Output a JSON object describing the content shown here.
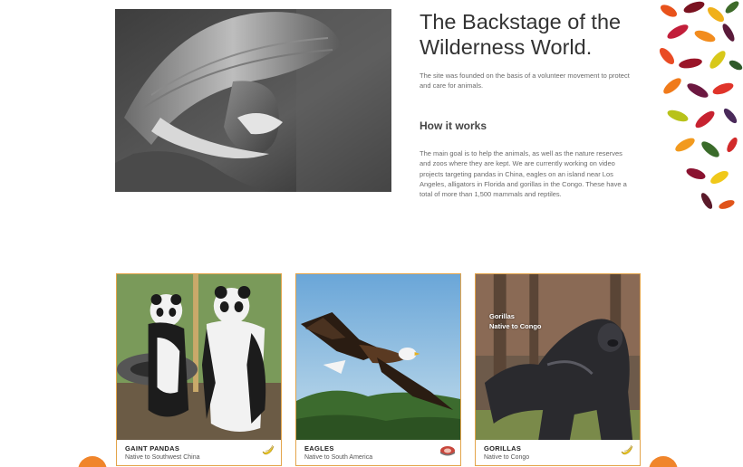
{
  "hero": {
    "title": "The Backstage of the Wilderness World.",
    "intro": "The site was founded on the basis of a volunteer movement to protect and care for animals.",
    "how_title": "How it works",
    "how_body": "The main goal is to help the animals, as well as the nature reserves and zoos where they are kept. We are currently working on video projects targeting pandas in China, eagles on an island near Los Angeles, alligators in Florida and gorillas in the Congo. These have a total of more than 1,500 mammals and reptiles.",
    "photo_icon": "old-man-portrait"
  },
  "cards": [
    {
      "name": "GAINT PANDAS",
      "native": "Native to Southwest China",
      "icon": "banana-icon"
    },
    {
      "name": "EAGLES",
      "native": "Native to South America",
      "icon": "meat-icon"
    },
    {
      "name": "GORILLAS",
      "native": "Native to Congo",
      "icon": "banana-icon",
      "overlay_title": "Gorillas",
      "overlay_sub": "Native to Congo"
    }
  ],
  "colors": {
    "accent_orange": "#f0852b",
    "card_border": "#e3a44a",
    "banana_yellow": "#f5d421",
    "meat_red": "#c8463c"
  }
}
